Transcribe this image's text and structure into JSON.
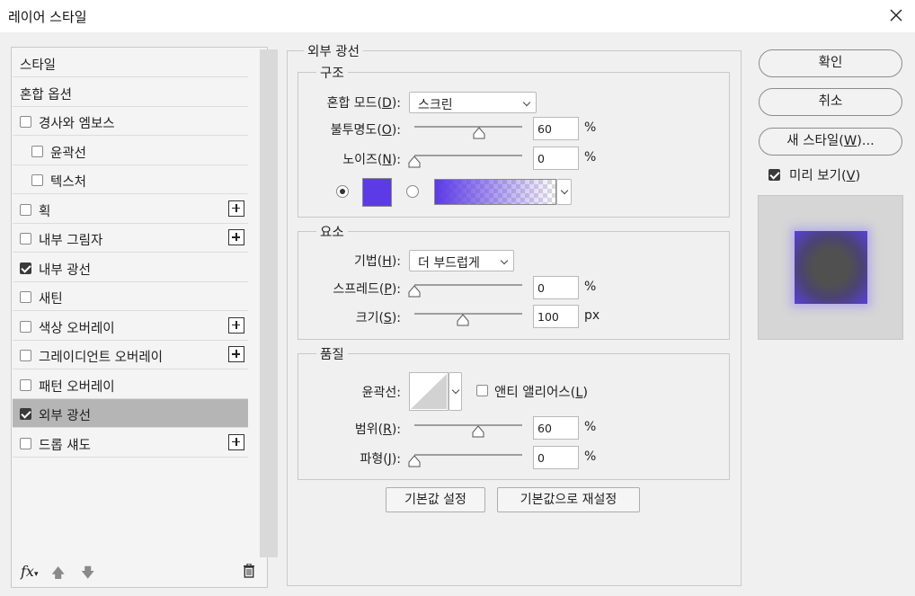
{
  "window": {
    "title": "레이어 스타일"
  },
  "style_list": {
    "items": [
      {
        "label": "스타일",
        "checkbox": false,
        "checked": false,
        "indent": 0,
        "plus": false,
        "selected": false
      },
      {
        "label": "혼합 옵션",
        "checkbox": false,
        "checked": false,
        "indent": 0,
        "plus": false,
        "selected": false
      },
      {
        "label": "경사와 엠보스",
        "checkbox": true,
        "checked": false,
        "indent": 0,
        "plus": false,
        "selected": false
      },
      {
        "label": "윤곽선",
        "checkbox": true,
        "checked": false,
        "indent": 1,
        "plus": false,
        "selected": false
      },
      {
        "label": "텍스처",
        "checkbox": true,
        "checked": false,
        "indent": 1,
        "plus": false,
        "selected": false
      },
      {
        "label": "획",
        "checkbox": true,
        "checked": false,
        "indent": 0,
        "plus": true,
        "selected": false
      },
      {
        "label": "내부 그림자",
        "checkbox": true,
        "checked": false,
        "indent": 0,
        "plus": true,
        "selected": false
      },
      {
        "label": "내부 광선",
        "checkbox": true,
        "checked": true,
        "indent": 0,
        "plus": false,
        "selected": false
      },
      {
        "label": "새틴",
        "checkbox": true,
        "checked": false,
        "indent": 0,
        "plus": false,
        "selected": false
      },
      {
        "label": "색상 오버레이",
        "checkbox": true,
        "checked": false,
        "indent": 0,
        "plus": true,
        "selected": false
      },
      {
        "label": "그레이디언트 오버레이",
        "checkbox": true,
        "checked": false,
        "indent": 0,
        "plus": true,
        "selected": false
      },
      {
        "label": "패턴 오버레이",
        "checkbox": true,
        "checked": false,
        "indent": 0,
        "plus": false,
        "selected": false
      },
      {
        "label": "외부 광선",
        "checkbox": true,
        "checked": true,
        "indent": 0,
        "plus": false,
        "selected": true
      },
      {
        "label": "드롭 섀도",
        "checkbox": true,
        "checked": false,
        "indent": 0,
        "plus": true,
        "selected": false
      }
    ],
    "footer": {
      "fx": "fx",
      "up_icon": "arrow-up-icon",
      "down_icon": "arrow-down-icon",
      "delete_icon": "trash-icon"
    }
  },
  "panel": {
    "title": "외부 광선",
    "structure": {
      "title": "구조",
      "blend_mode": {
        "label": "혼합 모드(",
        "key": "D",
        "suffix": "):",
        "value": "스크린"
      },
      "opacity": {
        "label": "불투명도(",
        "key": "O",
        "suffix": "):",
        "value": "60",
        "unit": "%"
      },
      "noise": {
        "label": "노이즈(",
        "key": "N",
        "suffix": "):",
        "value": "0",
        "unit": "%"
      },
      "color": "#5c3ae6",
      "gradient_start": "#5c3ae6"
    },
    "elements": {
      "title": "요소",
      "technique": {
        "label": "기법(",
        "key": "H",
        "suffix": "):",
        "value": "더 부드럽게"
      },
      "spread": {
        "label": "스프레드(",
        "key": "P",
        "suffix": "):",
        "value": "0",
        "unit": "%"
      },
      "size": {
        "label": "크기(",
        "key": "S",
        "suffix": "):",
        "value": "100",
        "unit": "px"
      }
    },
    "quality": {
      "title": "품질",
      "contour": {
        "label": "윤곽선:"
      },
      "anti_alias": {
        "label": "앤티 앨리어스(",
        "key": "L",
        "suffix": ")"
      },
      "range": {
        "label": "범위(",
        "key": "R",
        "suffix": "):",
        "value": "60",
        "unit": "%"
      },
      "jitter": {
        "label": "파형(",
        "key": "J",
        "suffix": "):",
        "value": "0",
        "unit": "%"
      }
    },
    "buttons": {
      "make_default": "기본값 설정",
      "reset_default": "기본값으로 재설정"
    }
  },
  "right": {
    "ok": "확인",
    "cancel": "취소",
    "new_style": {
      "label": "새 스타일(",
      "key": "W",
      "suffix": ")..."
    },
    "preview": {
      "label": "미리 보기(",
      "key": "V",
      "suffix": ")",
      "checked": true
    },
    "preview_colors": {
      "bg": "#d6d6d6",
      "glow": "#5c3ae6",
      "fill": "#505050"
    }
  }
}
